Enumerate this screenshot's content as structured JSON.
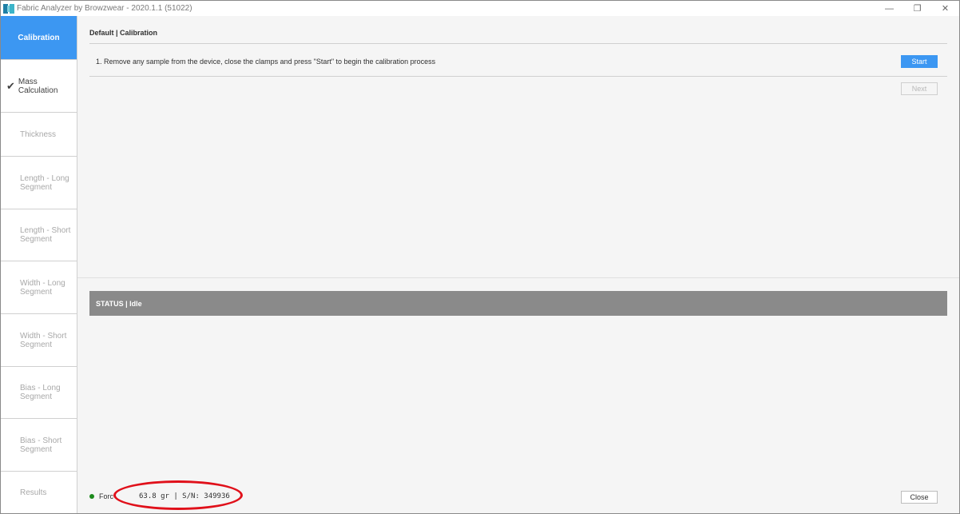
{
  "window": {
    "title": "Fabric Analyzer by Browzwear - 2020.1.1 (51022)",
    "icon": "fabric-analyzer-app-icon",
    "controls": {
      "minimize": "—",
      "maximize": "❐",
      "close": "✕"
    }
  },
  "sidebar": {
    "items": [
      {
        "label": "Calibration",
        "state": "active"
      },
      {
        "label": "Mass Calculation",
        "state": "done",
        "icon": "checkmark-icon"
      },
      {
        "label": "Thickness",
        "state": "disabled"
      },
      {
        "label": "Length - Long Segment",
        "state": "disabled"
      },
      {
        "label": "Length - Short Segment",
        "state": "disabled"
      },
      {
        "label": "Width - Long Segment",
        "state": "disabled"
      },
      {
        "label": "Width - Short Segment",
        "state": "disabled"
      },
      {
        "label": "Bias - Long Segment",
        "state": "disabled"
      },
      {
        "label": "Bias - Short Segment",
        "state": "disabled"
      },
      {
        "label": "Results",
        "state": "disabled"
      }
    ]
  },
  "main": {
    "breadcrumb": "Default | Calibration",
    "instruction": "1. Remove any sample from the device, close the clamps and press \"Start\" to begin the calibration process",
    "start_label": "Start",
    "next_label": "Next"
  },
  "status": {
    "text": "STATUS | Idle"
  },
  "footer": {
    "indicator_color": "#1c8a1c",
    "label": "Forc",
    "value": "63.8 gr | S/N: 349936",
    "close_label": "Close"
  },
  "colors": {
    "accent": "#3c97f2",
    "status_bar": "#8a8a8a",
    "annotation": "#e0101a"
  }
}
